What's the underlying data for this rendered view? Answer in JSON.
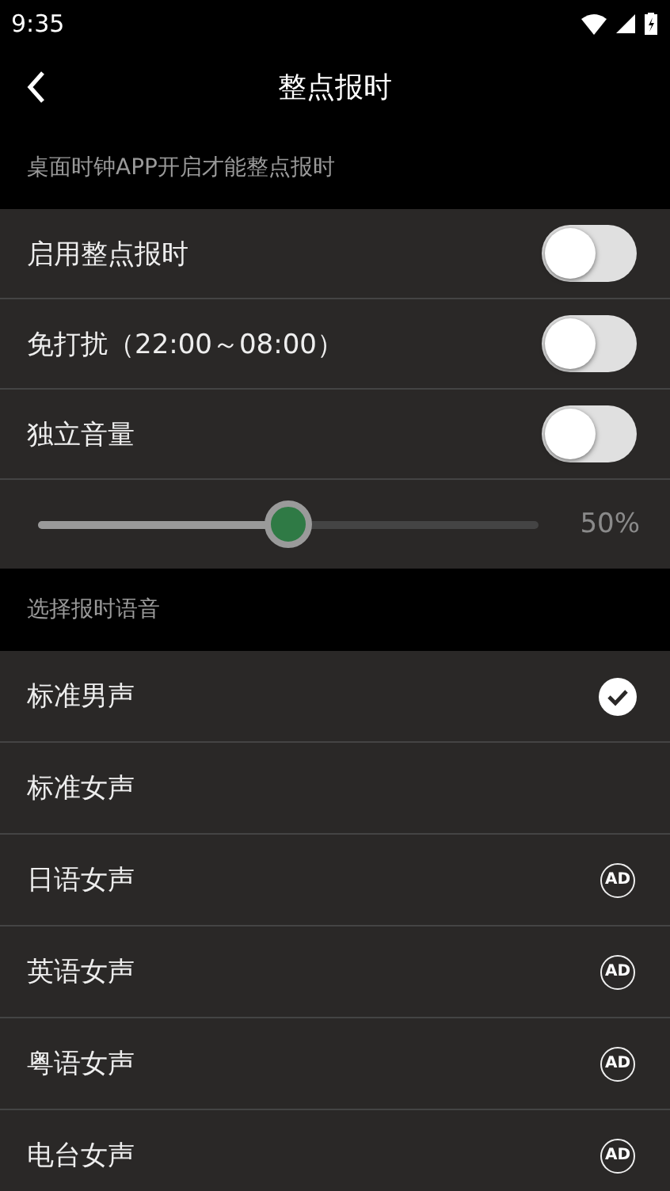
{
  "status_bar": {
    "time": "9:35"
  },
  "header": {
    "title": "整点报时"
  },
  "notice": "桌面时钟APP开启才能整点报时",
  "settings": [
    {
      "label": "启用整点报时",
      "on": false
    },
    {
      "label": "免打扰（22:00～08:00）",
      "on": false
    },
    {
      "label": "独立音量",
      "on": false
    }
  ],
  "volume": {
    "level": 0.5,
    "reading": "50%"
  },
  "voice_section": "选择报时语音",
  "voices": [
    {
      "label": "标准男声",
      "kind": "plain",
      "selected": true
    },
    {
      "label": "标准女声",
      "kind": "plain",
      "selected": false
    },
    {
      "label": "日语女声",
      "kind": "ad",
      "badge": "AD",
      "selected": false
    },
    {
      "label": "英语女声",
      "kind": "ad",
      "badge": "AD",
      "selected": false
    },
    {
      "label": "粤语女声",
      "kind": "ad",
      "badge": "AD",
      "selected": false
    },
    {
      "label": "电台女声",
      "kind": "ad",
      "badge": "AD",
      "selected": false
    }
  ]
}
